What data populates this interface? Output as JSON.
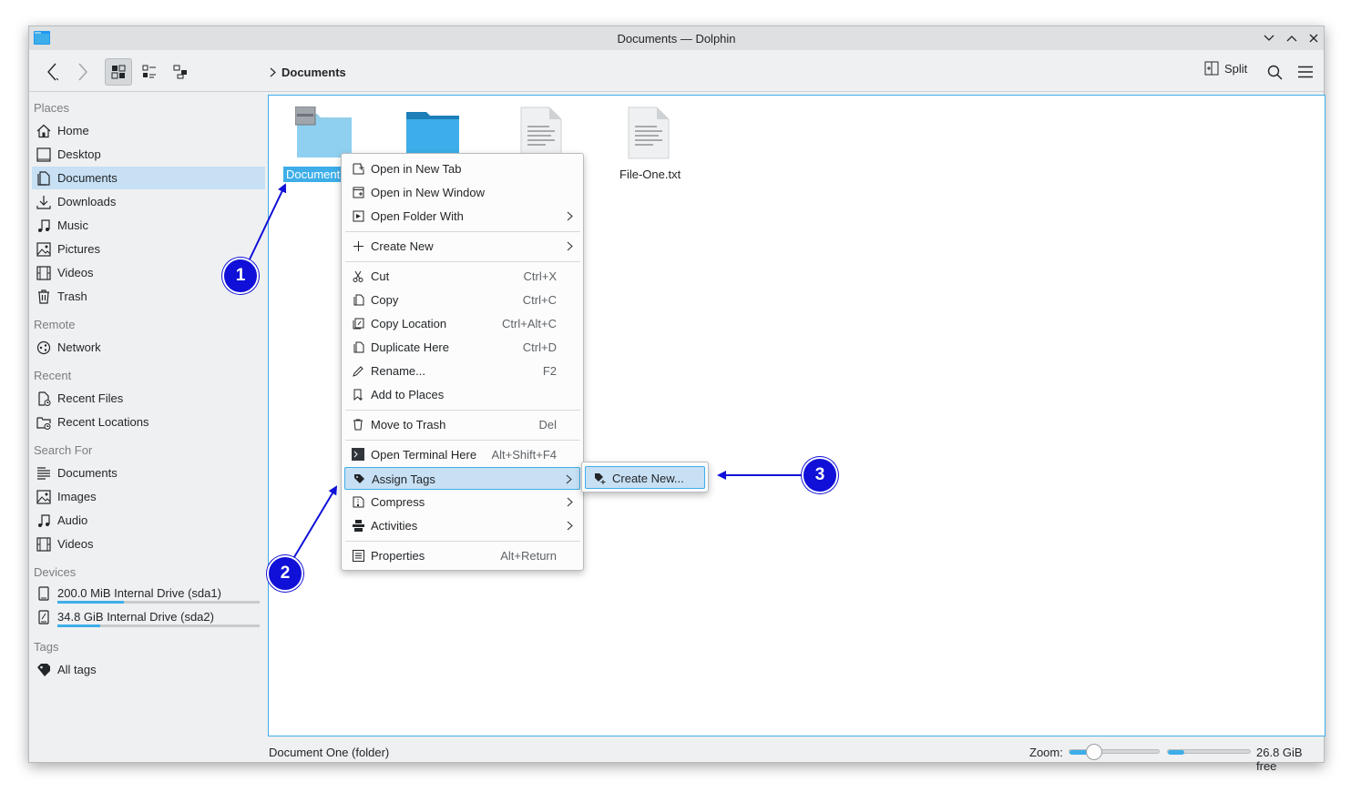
{
  "window": {
    "title": "Documents — Dolphin"
  },
  "toolbar": {
    "breadcrumb": "Documents",
    "split_label": "Split"
  },
  "sidebar": {
    "places_title": "Places",
    "places": [
      "Home",
      "Desktop",
      "Documents",
      "Downloads",
      "Music",
      "Pictures",
      "Videos",
      "Trash"
    ],
    "remote_title": "Remote",
    "remote": [
      "Network"
    ],
    "recent_title": "Recent",
    "recent": [
      "Recent Files",
      "Recent Locations"
    ],
    "search_title": "Search For",
    "search": [
      "Documents",
      "Images",
      "Audio",
      "Videos"
    ],
    "devices_title": "Devices",
    "devices": [
      {
        "label": "200.0 MiB Internal Drive (sda1)",
        "used_fraction": 0.33
      },
      {
        "label": "34.8 GiB Internal Drive (sda2)",
        "used_fraction": 0.21
      }
    ],
    "tags_title": "Tags",
    "tags": [
      "All tags"
    ]
  },
  "files": {
    "selected_label": "Document",
    "file_one": "File-One.txt"
  },
  "context_menu": {
    "items": [
      {
        "label": "Open in New Tab",
        "shortcut": ""
      },
      {
        "label": "Open in New Window",
        "shortcut": ""
      },
      {
        "label": "Open Folder With",
        "shortcut": ""
      },
      {
        "label": "Create New",
        "shortcut": ""
      },
      {
        "label": "Cut",
        "shortcut": "Ctrl+X"
      },
      {
        "label": "Copy",
        "shortcut": "Ctrl+C"
      },
      {
        "label": "Copy Location",
        "shortcut": "Ctrl+Alt+C"
      },
      {
        "label": "Duplicate Here",
        "shortcut": "Ctrl+D"
      },
      {
        "label": "Rename...",
        "shortcut": "F2"
      },
      {
        "label": "Add to Places",
        "shortcut": ""
      },
      {
        "label": "Move to Trash",
        "shortcut": "Del"
      },
      {
        "label": "Open Terminal Here",
        "shortcut": "Alt+Shift+F4"
      },
      {
        "label": "Assign Tags",
        "shortcut": ""
      },
      {
        "label": "Compress",
        "shortcut": ""
      },
      {
        "label": "Activities",
        "shortcut": ""
      },
      {
        "label": "Properties",
        "shortcut": "Alt+Return"
      }
    ]
  },
  "submenu": {
    "create_new": "Create New..."
  },
  "statusbar": {
    "text": "Document One (folder)",
    "zoom_label": "Zoom:",
    "zoom_fraction": 0.28,
    "free_label": "26.8 GiB free",
    "used_fraction": 0.2
  },
  "callouts": [
    "1",
    "2",
    "3"
  ],
  "colors": {
    "accent": "#3daee9",
    "highlight": "#c7e0f4",
    "callout": "#1010d8"
  }
}
